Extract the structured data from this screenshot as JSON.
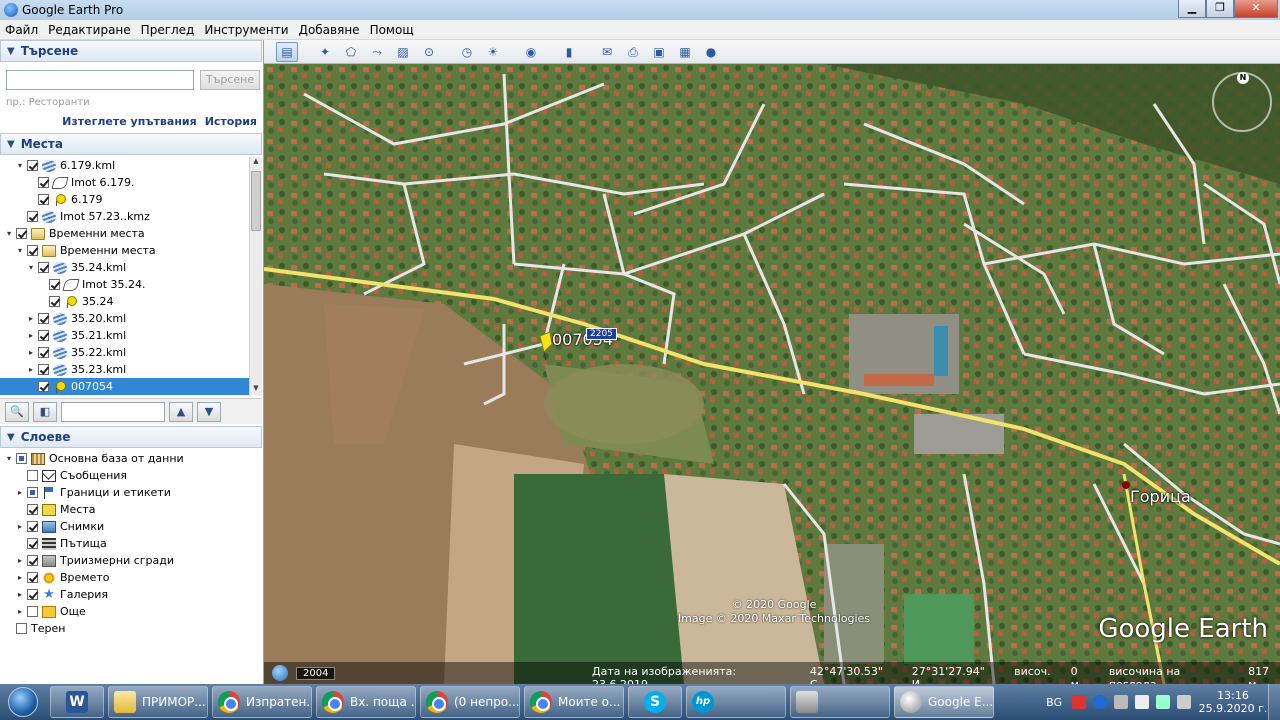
{
  "window": {
    "title": "Google Earth Pro"
  },
  "menu": [
    "Файл",
    "Редактиране",
    "Преглед",
    "Инструменти",
    "Добавяне",
    "Помощ"
  ],
  "search": {
    "header": "Търсене",
    "button": "Търсене",
    "hint": "пр.: Ресторанти",
    "clear_link": "Изтеглете упътвания",
    "history_link": "История"
  },
  "places": {
    "header": "Места",
    "items": [
      {
        "label": "6.179.kml",
        "indent": 1,
        "icon": "kml",
        "check": "on",
        "expander": "▾"
      },
      {
        "label": "Imot 6.179.",
        "indent": 2,
        "icon": "poly",
        "check": "on",
        "expander": ""
      },
      {
        "label": "6.179",
        "indent": 2,
        "icon": "pin",
        "check": "on",
        "expander": ""
      },
      {
        "label": "Imot 57.23..kmz",
        "indent": 1,
        "icon": "kml",
        "check": "on",
        "expander": ""
      },
      {
        "label": "Временни места",
        "indent": 0,
        "icon": "folder",
        "check": "on",
        "expander": "▾"
      },
      {
        "label": "Временни места",
        "indent": 1,
        "icon": "folder",
        "check": "on",
        "expander": "▾"
      },
      {
        "label": "35.24.kml",
        "indent": 2,
        "icon": "kml",
        "check": "on",
        "expander": "▾"
      },
      {
        "label": "Imot 35.24.",
        "indent": 3,
        "icon": "poly",
        "check": "on",
        "expander": ""
      },
      {
        "label": "35.24",
        "indent": 3,
        "icon": "pin",
        "check": "on",
        "expander": ""
      },
      {
        "label": "35.20.kml",
        "indent": 2,
        "icon": "kml",
        "check": "on",
        "expander": "▸"
      },
      {
        "label": "35.21.kml",
        "indent": 2,
        "icon": "kml",
        "check": "on",
        "expander": "▸"
      },
      {
        "label": "35.22.kml",
        "indent": 2,
        "icon": "kml",
        "check": "on",
        "expander": "▸"
      },
      {
        "label": "35.23.kml",
        "indent": 2,
        "icon": "kml",
        "check": "on",
        "expander": "▸"
      },
      {
        "label": "007054",
        "indent": 2,
        "icon": "pin",
        "check": "on",
        "expander": "",
        "selected": true
      }
    ]
  },
  "layers": {
    "header": "Слоеве",
    "items": [
      {
        "label": "Основна база от данни",
        "indent": 0,
        "icon": "db",
        "check": "partial",
        "expander": "▾"
      },
      {
        "label": "Съобщения",
        "indent": 1,
        "icon": "mail",
        "check": "off",
        "expander": ""
      },
      {
        "label": "Граници и етикети",
        "indent": 1,
        "icon": "flag",
        "check": "partial",
        "expander": "▸"
      },
      {
        "label": "Места",
        "indent": 1,
        "icon": "yellowbox",
        "check": "on",
        "expander": ""
      },
      {
        "label": "Снимки",
        "indent": 1,
        "icon": "photo",
        "check": "on",
        "expander": "▸"
      },
      {
        "label": "Пътища",
        "indent": 1,
        "icon": "road",
        "check": "on",
        "expander": ""
      },
      {
        "label": "Триизмерни сгради",
        "indent": 1,
        "icon": "building",
        "check": "on",
        "expander": "▸"
      },
      {
        "label": "Времето",
        "indent": 1,
        "icon": "sun",
        "check": "on",
        "expander": "▸"
      },
      {
        "label": "Галерия",
        "indent": 1,
        "icon": "star",
        "check": "on",
        "expander": "▸"
      },
      {
        "label": "Още",
        "indent": 1,
        "icon": "more",
        "check": "off",
        "expander": "▸"
      },
      {
        "label": "Терен",
        "indent": 0,
        "icon": "",
        "check": "off",
        "expander": ""
      }
    ]
  },
  "map": {
    "placemark_label": "007054",
    "road_shield": "2205",
    "town_label": "Горица",
    "copyright_1": "© 2020 Google",
    "copyright_2": "Image © 2020 Maxar Technologies",
    "logo": "Google Earth",
    "compass_n": "N",
    "year": "2004",
    "status": {
      "imagery_date": "Дата на изображенията: 23.6.2019",
      "lat": "42°47'30.53\" С",
      "lon": "27°31'27.94\" И",
      "elev_label": "височ.",
      "elev_value": "0 м",
      "eye_label": "височина на погледа",
      "eye_value": "817 м"
    }
  },
  "taskbar": {
    "tasks": [
      {
        "label": "",
        "icon": "word",
        "pinned": true,
        "icon_text": "W"
      },
      {
        "label": "ПРИМОР...",
        "icon": "folder"
      },
      {
        "label": "Изпратен...",
        "icon": "chrome"
      },
      {
        "label": "Вх. поща ...",
        "icon": "chrome"
      },
      {
        "label": "(0 непро...",
        "icon": "chrome"
      },
      {
        "label": "Моите о...",
        "icon": "chrome"
      },
      {
        "label": "",
        "icon": "skype",
        "pinned": true,
        "icon_text": "S"
      },
      {
        "label": "",
        "icon": "hp",
        "icon_text": "hp",
        "wide": true
      },
      {
        "label": "",
        "icon": "app",
        "wide": true
      },
      {
        "label": "Google E...",
        "icon": "ge",
        "active": true
      }
    ],
    "lang": "BG",
    "time": "13:16",
    "date": "25.9.2020 г."
  }
}
